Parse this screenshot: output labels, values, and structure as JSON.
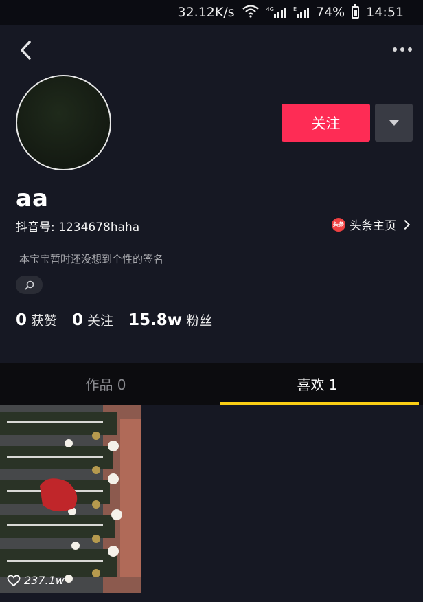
{
  "status_bar": {
    "speed": "32.12K/s",
    "net_4g": "4G",
    "net_e": "E",
    "battery": "74%",
    "time": "14:51"
  },
  "profile": {
    "nickname": "aa",
    "douyin_id": "抖音号: 1234678haha",
    "follow_label": "关注",
    "toutiao_badge": "头条",
    "toutiao_label": "头条主页",
    "signature": "本宝宝暂时还没想到个性的签名"
  },
  "stats": {
    "likes_count": "0",
    "likes_label": "获赞",
    "following_count": "0",
    "following_label": "关注",
    "fans_count": "15.8w",
    "fans_label": "粉丝"
  },
  "tabs": [
    {
      "label": "作品 0",
      "active": false
    },
    {
      "label": "喜欢 1",
      "active": true
    }
  ],
  "videos": [
    {
      "likes": "237.1w"
    }
  ],
  "colors": {
    "background": "#161823",
    "follow_button": "#fe2c55",
    "tab_indicator": "#face15"
  }
}
